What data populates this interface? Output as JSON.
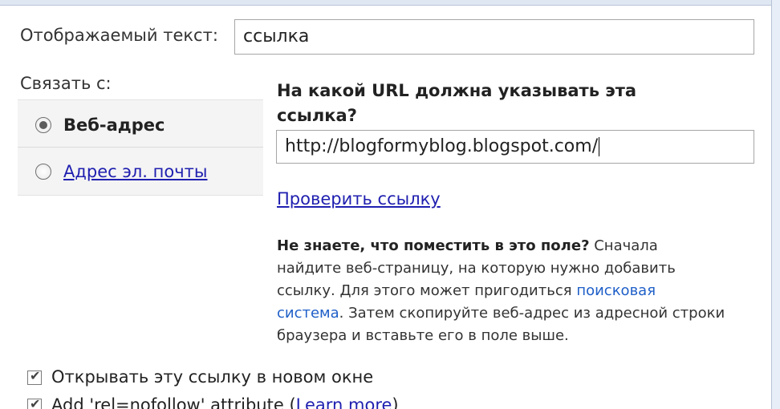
{
  "display_text": {
    "label": "Отображаемый текст:",
    "value": "ссылка"
  },
  "link_to": {
    "label": "Связать с:",
    "options": [
      {
        "label": "Веб-адрес",
        "selected": true
      },
      {
        "label": "Адрес эл. почты",
        "selected": false
      }
    ]
  },
  "url_section": {
    "heading_line1": "На какой URL должна указывать эта",
    "heading_line2": "ссылка?",
    "url_value": "http://blogformyblog.blogspot.com/",
    "test_link": "Проверить ссылку"
  },
  "help": {
    "bold": "Не знаете, что поместить в это поле?",
    "text1": " Сначала найдите веб-страницу, на которую нужно добавить ссылку. Для этого может пригодиться ",
    "search_link": "поисковая система",
    "text2": ". Затем скопируйте веб-адрес из адресной строки браузера и вставьте его в поле выше."
  },
  "options": {
    "new_window": "Открывать эту ссылку в новом окне",
    "nofollow_prefix": "Add 'rel=nofollow' attribute (",
    "nofollow_link": "Learn more",
    "nofollow_suffix": ")"
  },
  "colors": {
    "link": "#1f1fb0",
    "panel_bg": "#f4f4f4",
    "frame_edge": "#dfe7f3"
  }
}
